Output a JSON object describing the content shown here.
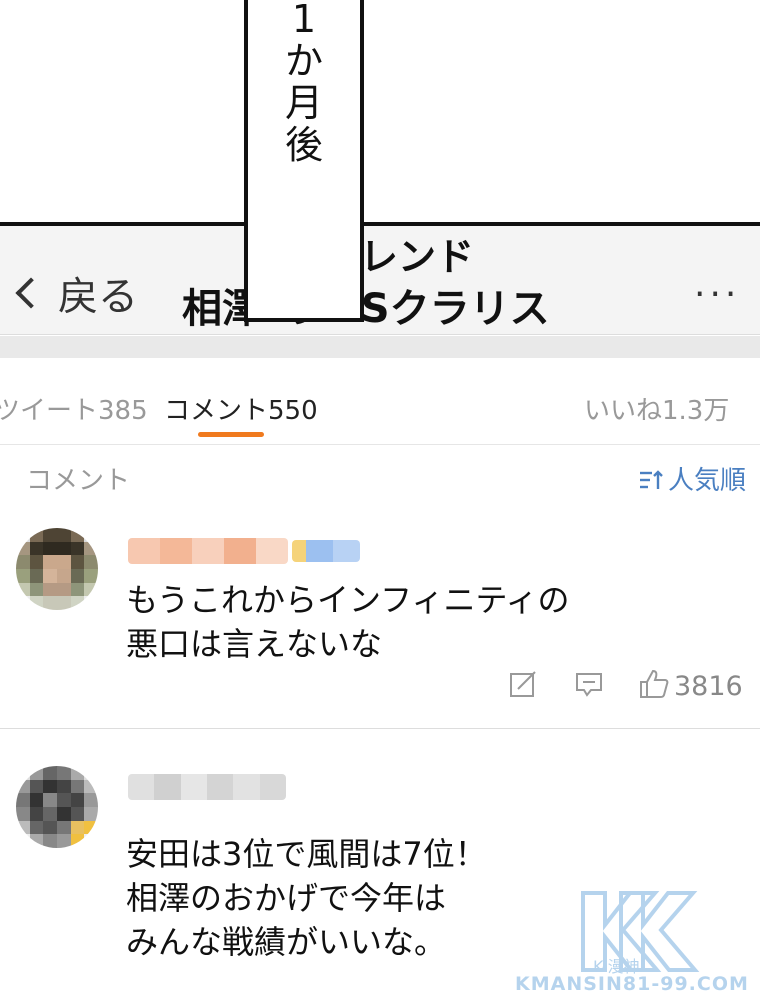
{
  "caption": {
    "lines": [
      "1",
      "か",
      "月",
      "後"
    ]
  },
  "header": {
    "back_label": "戻る",
    "title_line1": "レンド",
    "title_line2": "相澤 の VSクラリス",
    "more_label": "···"
  },
  "tabs": [
    {
      "label": "ツイート385",
      "active": false
    },
    {
      "label": "コメント550",
      "active": true
    },
    {
      "label": "いいね1.3万",
      "active": false
    }
  ],
  "section": {
    "label": "コメント",
    "sort_label": "人気順"
  },
  "comments": [
    {
      "text_line1": "もうこれからインフィニティの",
      "text_line2": "悪口は言えないな",
      "likes": "3816"
    },
    {
      "text_line1": "安田は3位で風間は7位！",
      "text_line2": "相澤のおかげで今年は",
      "text_line3": "みんな戦績がいいな。"
    }
  ],
  "watermark": {
    "url": "KMANSIN81-99.COM",
    "sub": "K-漫神"
  },
  "colors": {
    "accent": "#f07a1e",
    "link": "#4a7fc1"
  }
}
